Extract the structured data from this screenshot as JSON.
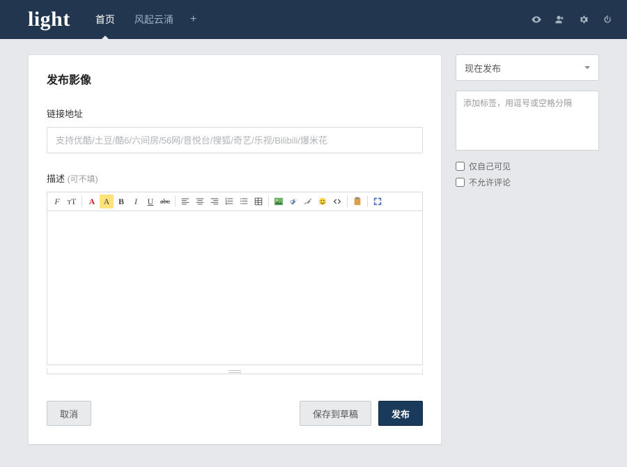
{
  "nav": {
    "brand": "light",
    "items": [
      "首页",
      "风起云涌"
    ],
    "activeIndex": 0,
    "add": "+"
  },
  "main": {
    "title": "发布影像",
    "url_section": {
      "label": "链接地址",
      "placeholder": "支持优酷/土豆/酷6/六间房/56网/音悦台/搜狐/奇艺/乐视/Bilibili/爆米花"
    },
    "desc_section": {
      "label": "描述",
      "hint": "(可不填)"
    },
    "toolbar": {
      "font_family": "F",
      "font_size": "ᴛT",
      "font_color": "A",
      "highlight": "A",
      "bold": "B",
      "italic": "I",
      "underline": "U",
      "strike": "abc"
    },
    "actions": {
      "cancel": "取消",
      "draft": "保存到草稿",
      "publish": "发布"
    }
  },
  "side": {
    "publish_time": "现在发布",
    "tag_placeholder": "添加标签，用逗号或空格分隔",
    "private_label": "仅自己可见",
    "no_comment_label": "不允许评论"
  }
}
